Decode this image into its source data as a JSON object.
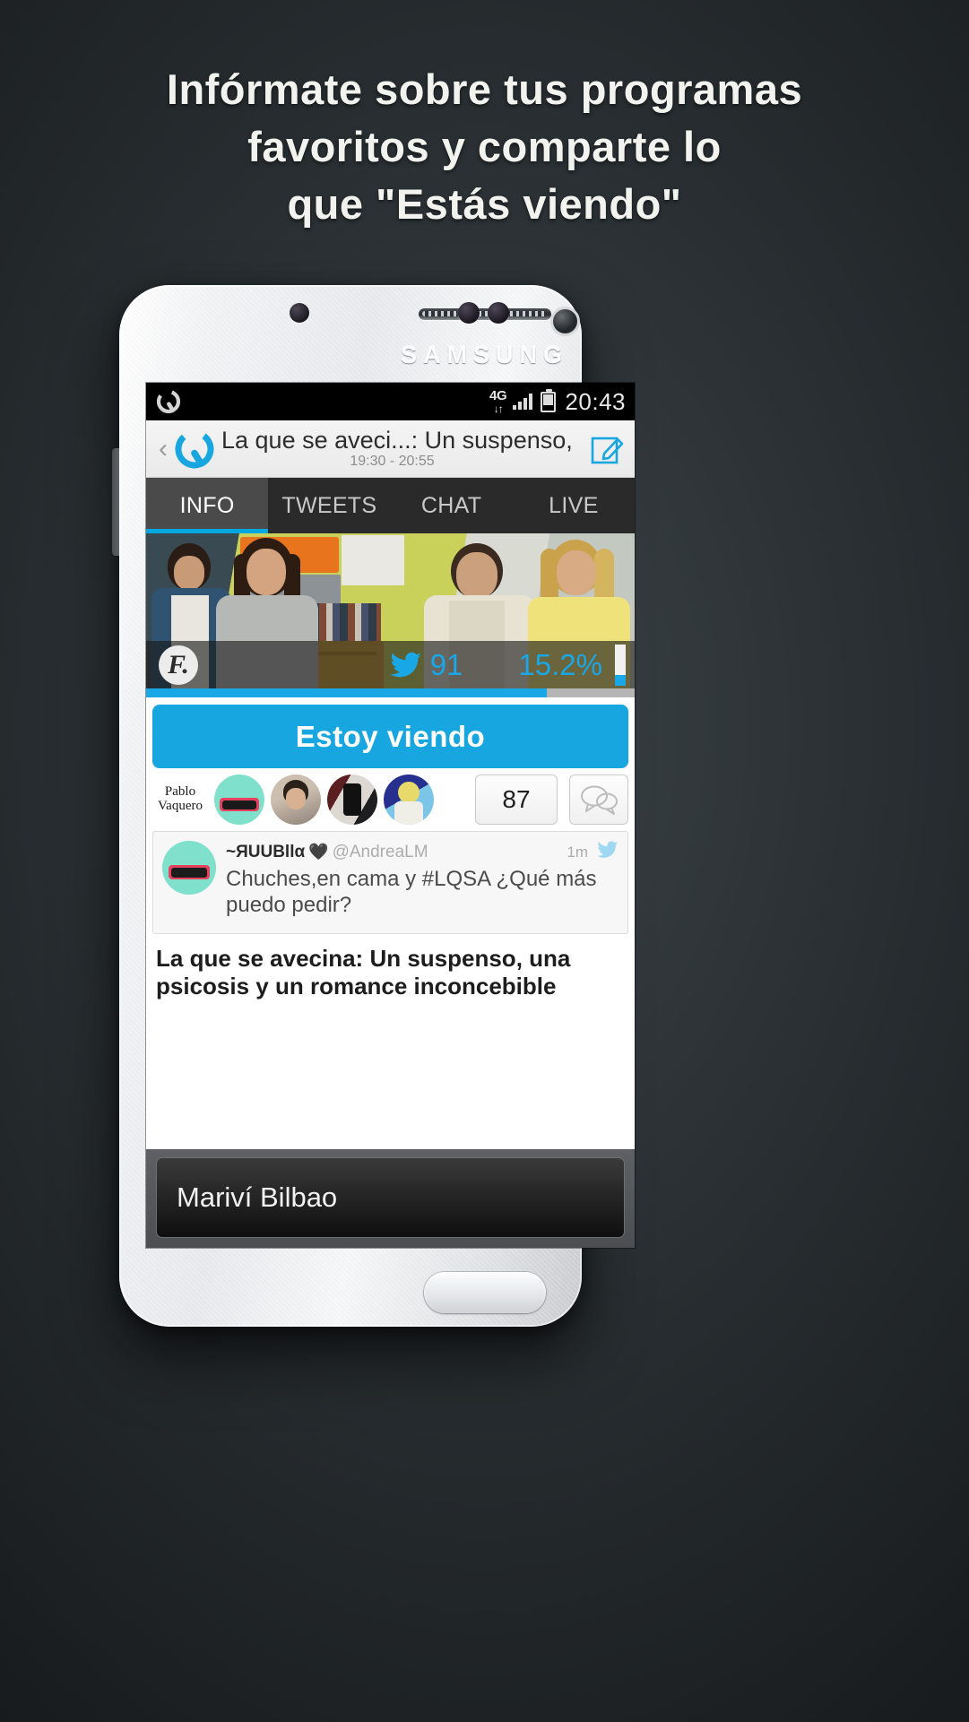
{
  "headline": {
    "line1": "Infórmate sobre tus programas",
    "line2": "favoritos y comparte lo",
    "line3": "que \"Estás viendo\""
  },
  "device": {
    "brand": "SAMSUNG"
  },
  "status_bar": {
    "app_icon": "q-logo-icon",
    "network": "4G",
    "data_arrows": "↓↑",
    "signal_icon": "signal-bars-icon",
    "battery_icon": "battery-icon",
    "time": "20:43"
  },
  "app_header": {
    "back_icon": "back-chevron-icon",
    "logo_icon": "q-logo-icon",
    "title": "La que se aveci...: Un suspenso,",
    "schedule": "19:30 - 20:55",
    "compose_icon": "compose-icon"
  },
  "tabs": [
    {
      "label": "INFO",
      "active": true
    },
    {
      "label": "TWEETS",
      "active": false
    },
    {
      "label": "CHAT",
      "active": false
    },
    {
      "label": "LIVE",
      "active": false
    }
  ],
  "hero": {
    "channel_logo": "F.",
    "twitter_icon": "twitter-bird-icon",
    "tweet_count": "91",
    "share_percent": "15.2%",
    "progress_percent": 82
  },
  "cta": {
    "label": "Estoy viendo"
  },
  "watchers": {
    "text_avatar_line1": "Pablo",
    "text_avatar_line2": "Vaquero",
    "count": "87",
    "chat_icon": "speech-bubbles-icon"
  },
  "tweet": {
    "name": "~ЯUUВllα",
    "heart": "🖤",
    "handle": "@AndreaLM",
    "age": "1m",
    "bird_icon": "twitter-bird-icon",
    "text": "Chuches,en cama y #LQSA ¿Qué más puedo pedir?"
  },
  "article": {
    "title": "La que se avecina: Un suspenso, una psicosis y un romance inconcebible"
  },
  "bottom_overlay": {
    "label": "Mariví Bilbao"
  },
  "colors": {
    "accent": "#17a6e0",
    "accent_text": "#19a7e6",
    "tab_active_bg": "#4a4a4a",
    "tab_bar_bg": "#2a2a2a",
    "page_bg": "#2c3236"
  }
}
